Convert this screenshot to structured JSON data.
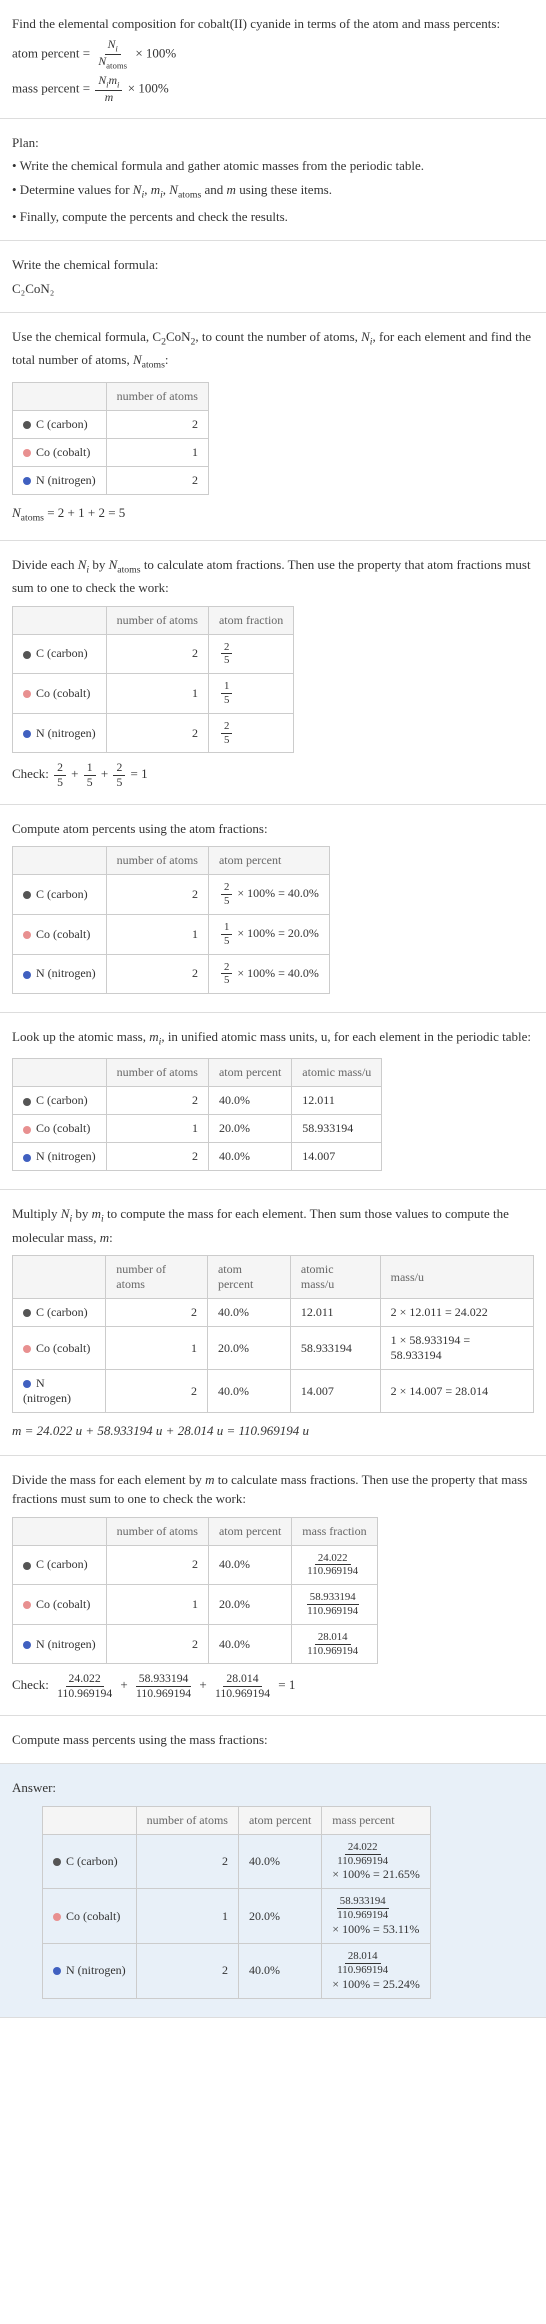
{
  "intro": {
    "line1": "Find the elemental composition for cobalt(II) cyanide in terms of the atom and mass percents:",
    "atom_percent_label": "atom percent",
    "mass_percent_label": "mass percent",
    "eq": "=",
    "times100": "× 100%",
    "Ni": "N",
    "Ni_sub": "i",
    "Natoms": "N",
    "Natoms_sub": "atoms",
    "Nimi_top": "N",
    "Nimi_top_sub": "i",
    "mi": "m",
    "mi_sub": "i",
    "m": "m"
  },
  "plan": {
    "heading": "Plan:",
    "b1": "• Write the chemical formula and gather atomic masses from the periodic table.",
    "b2_a": "• Determine values for ",
    "b2_b": " and ",
    "b2_c": " using these items.",
    "b3": "• Finally, compute the percents and check the results."
  },
  "formula": {
    "heading": "Write the chemical formula:",
    "text": "C₂CoN₂"
  },
  "count": {
    "intro_a": "Use the chemical formula, C",
    "intro_b": "CoN",
    "intro_c": ", to count the number of atoms, ",
    "intro_d": ", for each element and find the total number of atoms, ",
    "intro_e": ":",
    "sub2": "2",
    "col1": "",
    "col2": "number of atoms",
    "c_label": "C (carbon)",
    "co_label": "Co (cobalt)",
    "n_label": "N (nitrogen)",
    "c_n": "2",
    "co_n": "1",
    "n_n": "2",
    "total_a": "N",
    "total_b": " = 2 + 1 + 2 = 5"
  },
  "atomfrac": {
    "intro_a": "Divide each ",
    "intro_b": " by ",
    "intro_c": " to calculate atom fractions. Then use the property that atom fractions must sum to one to check the work:",
    "col3": "atom fraction",
    "c_frac_n": "2",
    "c_frac_d": "5",
    "co_frac_n": "1",
    "co_frac_d": "5",
    "n_frac_n": "2",
    "n_frac_d": "5",
    "check_label": "Check: ",
    "plus": " + ",
    "eq1": " = 1"
  },
  "atompct": {
    "intro": "Compute atom percents using the atom fractions:",
    "col3": "atom percent",
    "times": " × 100% = ",
    "c_pct": "40.0%",
    "co_pct": "20.0%",
    "n_pct": "40.0%"
  },
  "atomic_mass": {
    "intro_a": "Look up the atomic mass, ",
    "intro_b": ", in unified atomic mass units, u, for each element in the periodic table:",
    "col4": "atomic mass/u",
    "c_m": "12.011",
    "co_m": "58.933194",
    "n_m": "14.007"
  },
  "mult": {
    "intro_a": "Multiply ",
    "intro_b": " by ",
    "intro_c": " to compute the mass for each element. Then sum those values to compute the molecular mass, ",
    "intro_d": ":",
    "col5": "mass/u",
    "c_calc": "2 × 12.011 = 24.022",
    "co_calc": "1 × 58.933194 = 58.933194",
    "n_calc": "2 × 14.007 = 28.014",
    "total": "m = 24.022 u + 58.933194 u + 28.014 u = 110.969194 u"
  },
  "massfrac": {
    "intro_a": "Divide the mass for each element by ",
    "intro_b": " to calculate mass fractions. Then use the property that mass fractions must sum to one to check the work:",
    "col4": "mass fraction",
    "c_n": "24.022",
    "c_d": "110.969194",
    "co_n": "58.933194",
    "co_d": "110.969194",
    "n_n": "28.014",
    "n_d": "110.969194"
  },
  "masspct": {
    "intro": "Compute mass percents using the mass fractions:",
    "answer": "Answer:",
    "col4": "mass percent",
    "times": "× 100% = ",
    "c_pct": "21.65%",
    "co_pct": "53.11%",
    "n_pct": "25.24%"
  },
  "chart_data": {
    "type": "table",
    "title": "Elemental composition of cobalt(II) cyanide (C2CoN2)",
    "elements": [
      {
        "symbol": "C",
        "name": "carbon",
        "number_of_atoms": 2,
        "atom_fraction": 0.4,
        "atom_percent": 40.0,
        "atomic_mass_u": 12.011,
        "mass_u": 24.022,
        "mass_fraction": 0.2165,
        "mass_percent": 21.65
      },
      {
        "symbol": "Co",
        "name": "cobalt",
        "number_of_atoms": 1,
        "atom_fraction": 0.2,
        "atom_percent": 20.0,
        "atomic_mass_u": 58.933194,
        "mass_u": 58.933194,
        "mass_fraction": 0.5311,
        "mass_percent": 53.11
      },
      {
        "symbol": "N",
        "name": "nitrogen",
        "number_of_atoms": 2,
        "atom_fraction": 0.4,
        "atom_percent": 40.0,
        "atomic_mass_u": 14.007,
        "mass_u": 28.014,
        "mass_fraction": 0.2524,
        "mass_percent": 25.24
      }
    ],
    "N_atoms": 5,
    "molecular_mass_u": 110.969194
  }
}
